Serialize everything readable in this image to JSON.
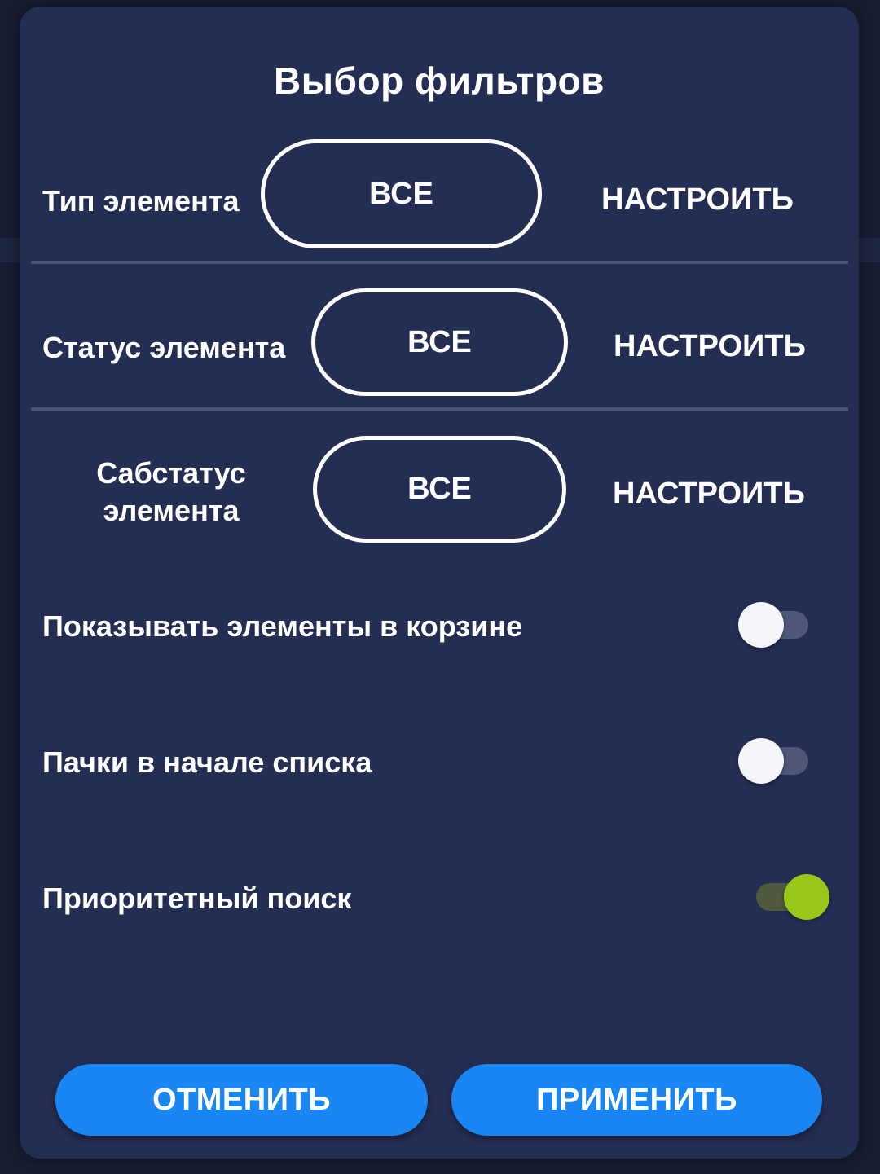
{
  "dialog": {
    "title": "Выбор фильтров",
    "filters": [
      {
        "label": "Тип элемента",
        "value": "ВСЕ",
        "configure_label": "НАСТРОИТЬ"
      },
      {
        "label": "Статус элемента",
        "value": "ВСЕ",
        "configure_label": "НАСТРОИТЬ"
      },
      {
        "label": "Сабстатус элемента",
        "value": "ВСЕ",
        "configure_label": "НАСТРОИТЬ"
      }
    ],
    "toggles": [
      {
        "label": "Показывать элементы в корзине",
        "checked": false
      },
      {
        "label": "Пачки в начале списка",
        "checked": false
      },
      {
        "label": "Приоритетный поиск",
        "checked": true
      }
    ],
    "cancel_label": "ОТМЕНИТЬ",
    "apply_label": "ПРИМЕНИТЬ"
  },
  "colors": {
    "dialog_background": "#242d52",
    "accent_button": "#1a86f4",
    "toggle_on": "#98c81a",
    "toggle_off_thumb": "#f4f5f8"
  }
}
